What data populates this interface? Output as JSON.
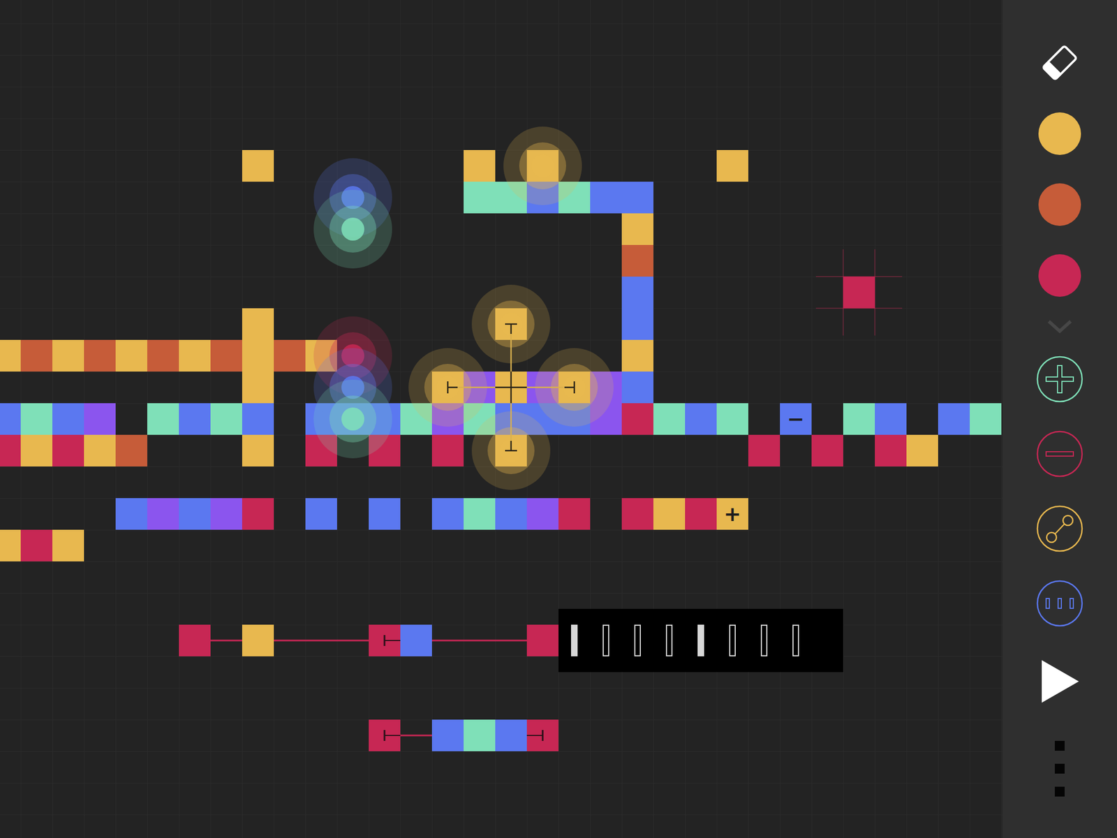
{
  "canvas": {
    "cells": [
      {
        "col": 7,
        "row": 4,
        "color": "#e8b84f"
      },
      {
        "col": 14,
        "row": 4,
        "color": "#e8b84f"
      },
      {
        "col": 16,
        "row": 4,
        "color": "#e8b84f"
      },
      {
        "col": 22,
        "row": 4,
        "color": "#e8b84f"
      },
      {
        "col": 14,
        "row": 5,
        "color": "#7fe0b8"
      },
      {
        "col": 15,
        "row": 5,
        "color": "#7fe0b8"
      },
      {
        "col": 16,
        "row": 5,
        "color": "#5b78f0"
      },
      {
        "col": 17,
        "row": 5,
        "color": "#7fe0b8"
      },
      {
        "col": 18,
        "row": 5,
        "color": "#5b78f0"
      },
      {
        "col": 19,
        "row": 5,
        "color": "#5b78f0"
      },
      {
        "col": 19,
        "row": 6,
        "color": "#e8b84f"
      },
      {
        "col": 19,
        "row": 7,
        "color": "#c65c39"
      },
      {
        "col": 19,
        "row": 8,
        "color": "#5b78f0"
      },
      {
        "col": 26,
        "row": 8,
        "color": "#c72754"
      },
      {
        "col": 7,
        "row": 9,
        "color": "#e8b84f"
      },
      {
        "col": 15,
        "row": 9,
        "color": "#e8b84f"
      },
      {
        "col": 19,
        "row": 9,
        "color": "#5b78f0"
      },
      {
        "col": -1,
        "row": 10,
        "color": "#e8b84f"
      },
      {
        "col": 0,
        "row": 10,
        "color": "#c65c39"
      },
      {
        "col": 1,
        "row": 10,
        "color": "#e8b84f"
      },
      {
        "col": 2,
        "row": 10,
        "color": "#c65c39"
      },
      {
        "col": 3,
        "row": 10,
        "color": "#e8b84f"
      },
      {
        "col": 4,
        "row": 10,
        "color": "#c65c39"
      },
      {
        "col": 5,
        "row": 10,
        "color": "#e8b84f"
      },
      {
        "col": 6,
        "row": 10,
        "color": "#c65c39"
      },
      {
        "col": 7,
        "row": 10,
        "color": "#e8b84f"
      },
      {
        "col": 8,
        "row": 10,
        "color": "#c65c39"
      },
      {
        "col": 9,
        "row": 10,
        "color": "#e8b84f"
      },
      {
        "col": 19,
        "row": 10,
        "color": "#e8b84f"
      },
      {
        "col": 7,
        "row": 11,
        "color": "#e8b84f"
      },
      {
        "col": 13,
        "row": 11,
        "color": "#e8b84f"
      },
      {
        "col": 14,
        "row": 11,
        "color": "#8b55ee"
      },
      {
        "col": 15,
        "row": 11,
        "color": "#e8b84f"
      },
      {
        "col": 16,
        "row": 11,
        "color": "#8b55ee"
      },
      {
        "col": 17,
        "row": 11,
        "color": "#e8b84f"
      },
      {
        "col": 18,
        "row": 11,
        "color": "#8b55ee"
      },
      {
        "col": 19,
        "row": 11,
        "color": "#5b78f0"
      },
      {
        "col": -1,
        "row": 12,
        "color": "#5b78f0"
      },
      {
        "col": 0,
        "row": 12,
        "color": "#7fe0b8"
      },
      {
        "col": 1,
        "row": 12,
        "color": "#5b78f0"
      },
      {
        "col": 2,
        "row": 12,
        "color": "#8b55ee"
      },
      {
        "col": 4,
        "row": 12,
        "color": "#7fe0b8"
      },
      {
        "col": 5,
        "row": 12,
        "color": "#5b78f0"
      },
      {
        "col": 6,
        "row": 12,
        "color": "#7fe0b8"
      },
      {
        "col": 7,
        "row": 12,
        "color": "#5b78f0"
      },
      {
        "col": 9,
        "row": 12,
        "color": "#5b78f0"
      },
      {
        "col": 10,
        "row": 12,
        "color": "#5b78f0"
      },
      {
        "col": 11,
        "row": 12,
        "color": "#5b78f0"
      },
      {
        "col": 12,
        "row": 12,
        "color": "#7fe0b8"
      },
      {
        "col": 13,
        "row": 12,
        "color": "#8b55ee"
      },
      {
        "col": 14,
        "row": 12,
        "color": "#7fe0b8"
      },
      {
        "col": 15,
        "row": 12,
        "color": "#5b78f0"
      },
      {
        "col": 16,
        "row": 12,
        "color": "#5b78f0"
      },
      {
        "col": 17,
        "row": 12,
        "color": "#5b78f0"
      },
      {
        "col": 18,
        "row": 12,
        "color": "#8b55ee"
      },
      {
        "col": 19,
        "row": 12,
        "color": "#c72754"
      },
      {
        "col": 20,
        "row": 12,
        "color": "#7fe0b8"
      },
      {
        "col": 21,
        "row": 12,
        "color": "#5b78f0"
      },
      {
        "col": 22,
        "row": 12,
        "color": "#7fe0b8"
      },
      {
        "col": 24,
        "row": 12,
        "color": "#5b78f0",
        "symbol": "−"
      },
      {
        "col": 26,
        "row": 12,
        "color": "#7fe0b8"
      },
      {
        "col": 27,
        "row": 12,
        "color": "#5b78f0"
      },
      {
        "col": 29,
        "row": 12,
        "color": "#5b78f0"
      },
      {
        "col": 30,
        "row": 12,
        "color": "#7fe0b8"
      },
      {
        "col": -1,
        "row": 13,
        "color": "#c72754"
      },
      {
        "col": 0,
        "row": 13,
        "color": "#e8b84f"
      },
      {
        "col": 1,
        "row": 13,
        "color": "#c72754"
      },
      {
        "col": 2,
        "row": 13,
        "color": "#e8b84f"
      },
      {
        "col": 3,
        "row": 13,
        "color": "#c65c39"
      },
      {
        "col": 7,
        "row": 13,
        "color": "#e8b84f"
      },
      {
        "col": 9,
        "row": 13,
        "color": "#c72754"
      },
      {
        "col": 11,
        "row": 13,
        "color": "#c72754"
      },
      {
        "col": 13,
        "row": 13,
        "color": "#c72754"
      },
      {
        "col": 15,
        "row": 13,
        "color": "#e8b84f"
      },
      {
        "col": 23,
        "row": 13,
        "color": "#c72754"
      },
      {
        "col": 25,
        "row": 13,
        "color": "#c72754"
      },
      {
        "col": 27,
        "row": 13,
        "color": "#c72754"
      },
      {
        "col": 28,
        "row": 13,
        "color": "#e8b84f"
      },
      {
        "col": 3,
        "row": 15,
        "color": "#5b78f0"
      },
      {
        "col": 4,
        "row": 15,
        "color": "#8b55ee"
      },
      {
        "col": 5,
        "row": 15,
        "color": "#5b78f0"
      },
      {
        "col": 6,
        "row": 15,
        "color": "#8b55ee"
      },
      {
        "col": 7,
        "row": 15,
        "color": "#c72754"
      },
      {
        "col": 9,
        "row": 15,
        "color": "#5b78f0"
      },
      {
        "col": 11,
        "row": 15,
        "color": "#5b78f0"
      },
      {
        "col": 13,
        "row": 15,
        "color": "#5b78f0"
      },
      {
        "col": 14,
        "row": 15,
        "color": "#7fe0b8"
      },
      {
        "col": 15,
        "row": 15,
        "color": "#5b78f0"
      },
      {
        "col": 16,
        "row": 15,
        "color": "#8b55ee"
      },
      {
        "col": 17,
        "row": 15,
        "color": "#c72754"
      },
      {
        "col": 19,
        "row": 15,
        "color": "#c72754"
      },
      {
        "col": 20,
        "row": 15,
        "color": "#e8b84f"
      },
      {
        "col": 21,
        "row": 15,
        "color": "#c72754"
      },
      {
        "col": 22,
        "row": 15,
        "color": "#e8b84f",
        "symbol": "+"
      },
      {
        "col": -1,
        "row": 16,
        "color": "#e8b84f"
      },
      {
        "col": 0,
        "row": 16,
        "color": "#c72754"
      },
      {
        "col": 1,
        "row": 16,
        "color": "#e8b84f"
      },
      {
        "col": 5,
        "row": 19,
        "color": "#c72754"
      },
      {
        "col": 7,
        "row": 19,
        "color": "#e8b84f"
      },
      {
        "col": 11,
        "row": 19,
        "color": "#c72754",
        "marker": "start"
      },
      {
        "col": 12,
        "row": 19,
        "color": "#5b78f0"
      },
      {
        "col": 16,
        "row": 19,
        "color": "#c72754"
      },
      {
        "col": 11,
        "row": 22,
        "color": "#c72754",
        "marker": "start"
      },
      {
        "col": 13,
        "row": 22,
        "color": "#5b78f0"
      },
      {
        "col": 14,
        "row": 22,
        "color": "#7fe0b8"
      },
      {
        "col": 15,
        "row": 22,
        "color": "#5b78f0"
      },
      {
        "col": 16,
        "row": 22,
        "color": "#c72754",
        "marker": "end"
      }
    ],
    "tracks": [
      {
        "row": 19,
        "from": 5,
        "to": 16,
        "color": "#c72754"
      },
      {
        "row": 22,
        "from": 11,
        "to": 16,
        "color": "#c72754"
      }
    ],
    "playheads": [
      {
        "col": 10,
        "row": 5,
        "color": "#5b78f0"
      },
      {
        "col": 10,
        "row": 6,
        "color": "#7fe0b8"
      },
      {
        "col": 10,
        "row": 10,
        "color": "#c72754"
      },
      {
        "col": 10,
        "row": 11,
        "color": "#5b78f0"
      },
      {
        "col": 10,
        "row": 12,
        "color": "#7fe0b8"
      },
      {
        "col": 16,
        "row": 4,
        "color": "#e8b84f"
      },
      {
        "col": 15,
        "row": 9,
        "color": "#e8b84f"
      },
      {
        "col": 13,
        "row": 11,
        "color": "#e8b84f"
      },
      {
        "col": 17,
        "row": 11,
        "color": "#e8b84f"
      },
      {
        "col": 15,
        "row": 13,
        "color": "#e8b84f"
      }
    ],
    "cross": {
      "col": 15,
      "row": 11,
      "reach": 2
    },
    "cursor": {
      "col": 26,
      "row": 8,
      "color": "#c72754"
    },
    "sequencer": {
      "col": 17,
      "row": 19,
      "steps": [
        true,
        false,
        false,
        false,
        true,
        false,
        false,
        false
      ]
    }
  },
  "sidebar": {
    "tools": [
      {
        "kind": "eraser"
      },
      {
        "kind": "color",
        "color": "#e8b84f"
      },
      {
        "kind": "color",
        "color": "#c65c39"
      },
      {
        "kind": "color",
        "color": "#c72754"
      },
      {
        "kind": "expand"
      },
      {
        "kind": "add",
        "color": "#7fe0b8"
      },
      {
        "kind": "remove",
        "color": "#c72754"
      },
      {
        "kind": "link",
        "color": "#e8b84f"
      },
      {
        "kind": "pattern",
        "color": "#5b78f0"
      },
      {
        "kind": "play"
      },
      {
        "kind": "more"
      }
    ]
  }
}
